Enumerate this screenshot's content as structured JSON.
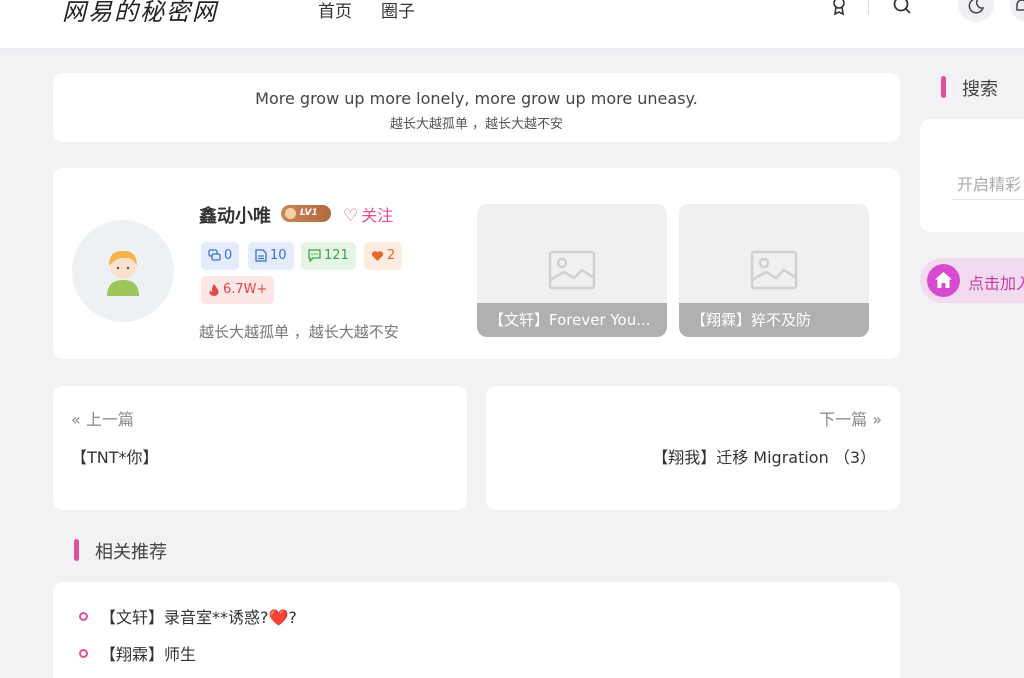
{
  "header": {
    "logo": "网易的秘密网",
    "nav": [
      "首页",
      "圈子"
    ]
  },
  "motto": {
    "en": "More grow up more lonely, more grow up more uneasy.",
    "cn": "越长大越孤单 ，越长大越不安"
  },
  "author": {
    "name": "鑫动小唯",
    "level": "LV1",
    "follow_label": "关注",
    "stats": {
      "questions": "0",
      "articles": "10",
      "comments": "121",
      "likes": "2",
      "popularity": "6.7W+"
    },
    "description": "越长大越孤单 ，越长大越不安",
    "posts": [
      {
        "title": "【文轩】Forever You..."
      },
      {
        "title": "【翔霖】猝不及防"
      }
    ]
  },
  "prev_next": {
    "prev_label": "上一篇",
    "prev_title": "【TNT*你】",
    "next_label": "下一篇",
    "next_title": "【翔我】迁移 Migration （3）"
  },
  "related": {
    "title": "相关推荐",
    "items": [
      "【文轩】录音室**诱惑?❤️?",
      "【翔霖】师生"
    ]
  },
  "sidebar": {
    "search_title": "搜索",
    "search_placeholder": "开启精彩",
    "join_label": "点击加入"
  },
  "colors": {
    "accent": "#e0509a",
    "page_bg": "#f2f2f5"
  }
}
